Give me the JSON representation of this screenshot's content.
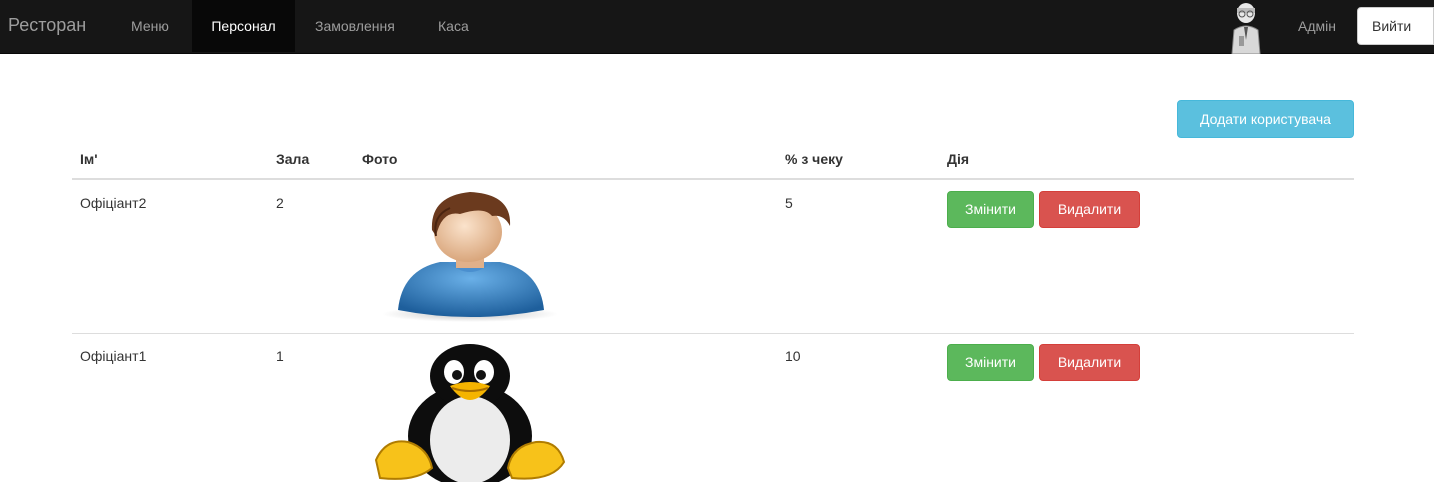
{
  "navbar": {
    "brand": "Ресторан",
    "items": [
      {
        "label": "Меню",
        "active": false
      },
      {
        "label": "Персонал",
        "active": true
      },
      {
        "label": "Замовлення",
        "active": false
      },
      {
        "label": "Каса",
        "active": false
      }
    ],
    "user_name": "Адмін",
    "logout_label": "Вийти"
  },
  "toolbar": {
    "add_user_label": "Додати користувача"
  },
  "table": {
    "headers": [
      "Ім'",
      "Зала",
      "Фото",
      "% з чеку",
      "Дія"
    ],
    "rows": [
      {
        "name": "Офіціант2",
        "hall": "2",
        "photo": "person-avatar",
        "percent": "5",
        "edit_label": "Змінити",
        "delete_label": "Видалити"
      },
      {
        "name": "Офіціант1",
        "hall": "1",
        "photo": "penguin-avatar",
        "percent": "10",
        "edit_label": "Змінити",
        "delete_label": "Видалити"
      }
    ]
  },
  "colors": {
    "navbar_bg": "#161616",
    "info": "#5bc0de",
    "success": "#5cb85c",
    "danger": "#d9534f"
  }
}
